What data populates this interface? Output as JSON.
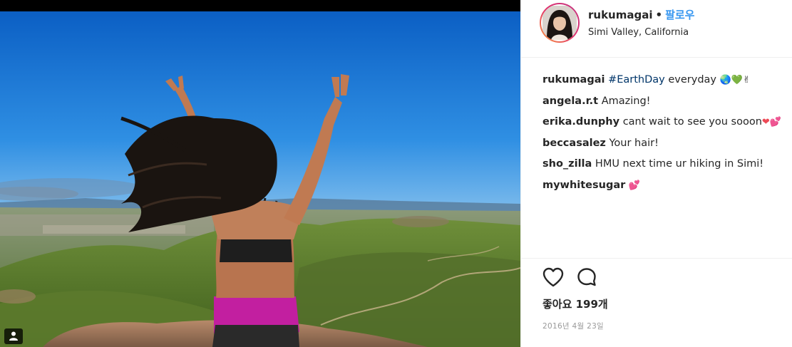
{
  "post": {
    "username": "rukumagai",
    "separator": "•",
    "follow_label": "팔로우",
    "location": "Simi Valley, California"
  },
  "caption": {
    "username": "rukumagai",
    "hashtag": "#EarthDay",
    "text": "everyday",
    "emoji": "🌏💚✌"
  },
  "comments": [
    {
      "username": "angela.r.t",
      "text": "Amazing!",
      "emoji": ""
    },
    {
      "username": "erika.dunphy",
      "text": "cant wait to see you sooon",
      "emoji": "❤💕"
    },
    {
      "username": "beccasalez",
      "text": "Your hair!",
      "emoji": ""
    },
    {
      "username": "sho_zilla",
      "text": "HMU next time ur hiking in Simi!",
      "emoji": ""
    },
    {
      "username": "mywhitesugar",
      "text": "",
      "emoji": "💕"
    }
  ],
  "likes_label": "좋아요 199개",
  "date": "2016년 4월 23일",
  "icons": {
    "like": "heart-icon",
    "comment": "comment-icon",
    "tag": "user-tag-icon"
  },
  "colors": {
    "follow": "#3897f0",
    "hashtag": "#003569",
    "heart_emoji": "#ed4956"
  }
}
